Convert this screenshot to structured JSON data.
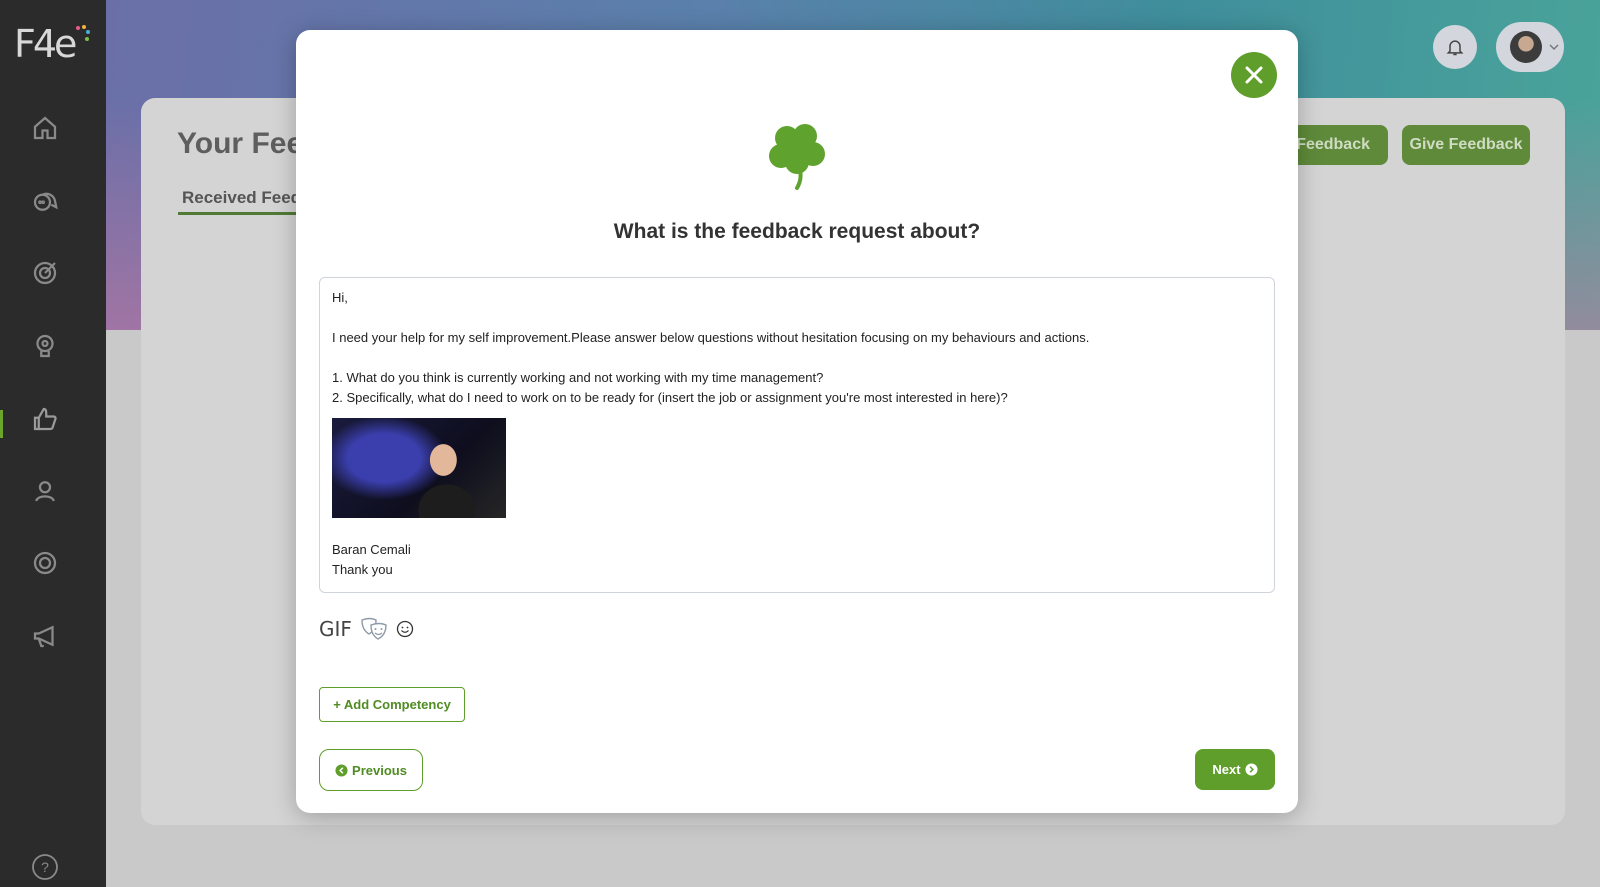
{
  "app": {
    "logo_text": "F4e"
  },
  "sidebar": {
    "items": [
      {
        "name": "home-icon"
      },
      {
        "name": "chat-icon"
      },
      {
        "name": "target-icon"
      },
      {
        "name": "lightbulb-icon"
      },
      {
        "name": "thumbs-up-icon",
        "active": true
      },
      {
        "name": "people-icon"
      },
      {
        "name": "settings-icon"
      },
      {
        "name": "megaphone-icon"
      }
    ],
    "help_icon": "help-icon"
  },
  "background": {
    "page_title": "Your Feed",
    "tab_received": "Received Feedb",
    "request_button": "st Feedback",
    "give_button": "Give Feedback"
  },
  "modal": {
    "title": "What is the feedback request about?",
    "message_lines": [
      "Hi,",
      "",
      "I need your help for my self improvement.Please answer below questions without hesitation focusing on my behaviours and actions.",
      "",
      "1. What do you think is currently working and not working with my time management?",
      "2. Specifically, what do I need to work on to be ready for (insert the job or assignment you're most interested in here)?"
    ],
    "signature_name": "Baran Cemali",
    "signature_closing": "Thank you",
    "gif_label": "GIF",
    "add_competency": "+ Add Competency",
    "previous": "Previous",
    "next": "Next"
  },
  "colors": {
    "accent": "#5f9e2a",
    "sidebar": "#2b2b2b"
  }
}
